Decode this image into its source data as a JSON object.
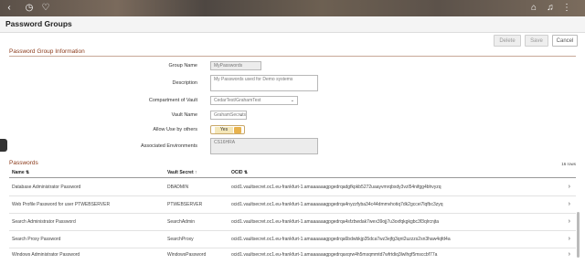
{
  "page": {
    "title": "Password Groups"
  },
  "toolbar": {
    "delete_label": "Delete",
    "save_label": "Save",
    "cancel_label": "Cancel"
  },
  "info": {
    "heading": "Password Group Information",
    "group_name_label": "Group Name",
    "group_name_value": "MyPasswords",
    "description_label": "Description",
    "description_value": "My Passwords used for Demo systems",
    "compartment_label": "Compartment of Vault",
    "compartment_value": "CedarTest/GrahamTest",
    "vault_label": "Vault Name",
    "vault_value": "GrahamSecrets",
    "allow_label": "Allow Use by others",
    "allow_value": "Yes",
    "envs_label": "Associated Environments",
    "envs_value": "CS16HRA"
  },
  "passwords": {
    "heading": "Passwords",
    "row_count": "16 rows",
    "columns": [
      "Name ⇅",
      "Vault Secret ↑",
      "OCID ⇅"
    ],
    "rows": [
      {
        "name": "Database Administrator Password",
        "secret": "DBADMIN",
        "ocid": "ocid1.vaultsecret.oc1.eu-frankfurt-1.amaaaaaagpgedrqadgfkpkb5272uaayvmrqbxdy3vzl54nifgg4bhvyzq"
      },
      {
        "name": "Web Profile Password for user PTWEBSERVER",
        "secret": "PTWEBSERVER",
        "ocid": "ocid1.vaultsecret.oc1.eu-frankfurt-1.amaaaaaagpgedrqa4nyzzfyba34c44dmmvhotiq7dk2gccei7lqfbc3zyq"
      },
      {
        "name": "Search Administrator Password",
        "secret": "SearchAdmin",
        "ocid": "ocid1.vaultsecret.oc1.eu-frankfurt-1.amaaaaaagpgedrqa4sfzbwdak7wex39ojj7u3oxfqkgkgbc3f3qlrcnjta"
      },
      {
        "name": "Search Proxy Password",
        "secret": "SearchProxy",
        "ocid": "ocid1.vaultsecret.oc1.eu-frankfurt-1.amaaaaaagpgedrqa6bdwbkjp35dca7wz3ejfg3qnt2uzzzs2sn3haw4qfd4a"
      },
      {
        "name": "Windows Administrator Password",
        "secret": "WindowsPassword",
        "ocid": "ocid1.vaultsecret.oc1.eu-frankfurt-1.amaaaaaagpgedrqaxqrw4h5msqmmtd7wfrtdiq3lwlhgf5msccbf77a"
      }
    ]
  }
}
